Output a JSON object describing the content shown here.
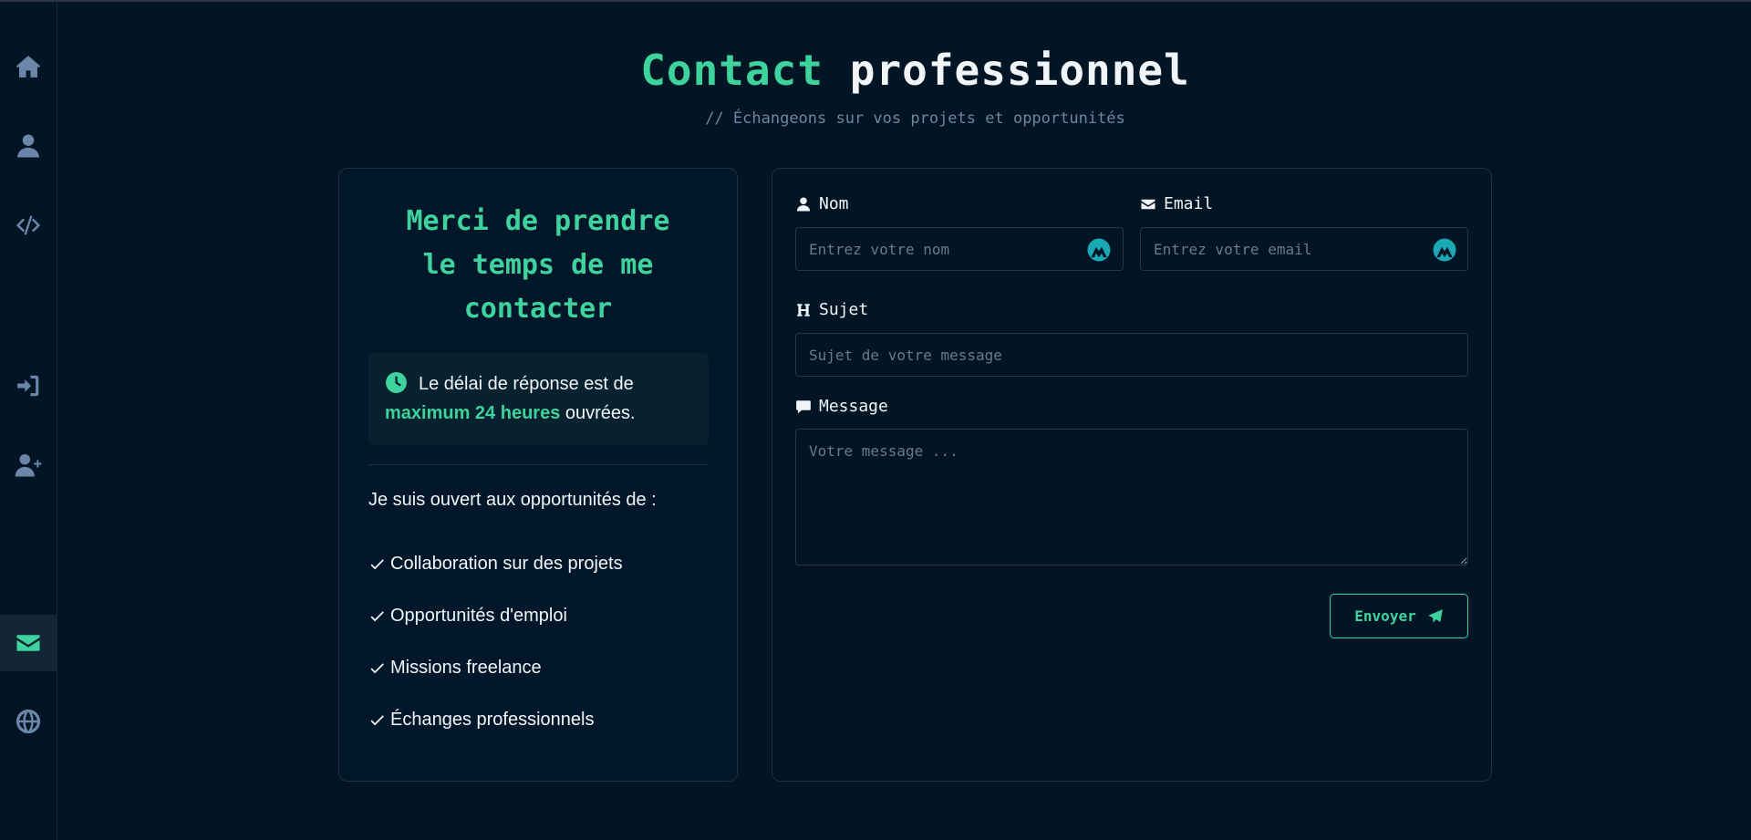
{
  "sidebar": {
    "items": [
      {
        "icon": "home-icon"
      },
      {
        "icon": "user-icon"
      },
      {
        "icon": "code-icon"
      },
      {
        "icon": "login-icon"
      },
      {
        "icon": "user-plus-icon"
      },
      {
        "icon": "envelope-icon",
        "active": true
      },
      {
        "icon": "globe-icon"
      }
    ]
  },
  "header": {
    "title_accent": "Contact",
    "title_rest": "professionnel",
    "subtitle": "// Échangeons sur vos projets et opportunités"
  },
  "info": {
    "title": "Merci de prendre le temps de me contacter",
    "delay_prefix": "Le délai de réponse est de",
    "delay_strong": "maximum 24 heures",
    "delay_suffix": "ouvrées.",
    "open_text": "Je suis ouvert aux opportunités de :",
    "opportunities": [
      "Collaboration sur des projets",
      "Opportunités d'emploi",
      "Missions freelance",
      "Échanges professionnels"
    ]
  },
  "form": {
    "name_label": "Nom",
    "name_placeholder": "Entrez votre nom",
    "email_label": "Email",
    "email_placeholder": "Entrez votre email",
    "subject_label": "Sujet",
    "subject_placeholder": "Sujet de votre message",
    "message_label": "Message",
    "message_placeholder": "Votre message ...",
    "submit_label": "Envoyer"
  },
  "colors": {
    "background": "#021524",
    "accent": "#3ed39c",
    "muted": "#6b86a8"
  }
}
